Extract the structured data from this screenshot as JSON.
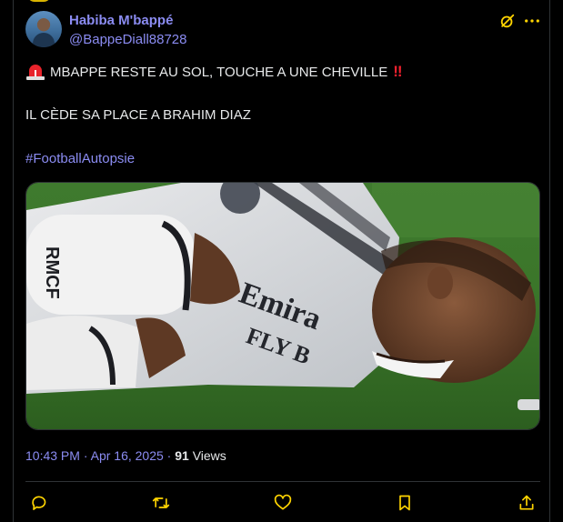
{
  "tweet": {
    "author": {
      "display_name": "Habiba M'bappé",
      "handle": "@BappeDiall88728"
    },
    "lines": {
      "first": "MBAPPE RESTE AU SOL, TOUCHE A UNE CHEVILLE",
      "second": "IL CÈDE SA PLACE A BRAHIM DIAZ",
      "hashtag": "#FootballAutopsie"
    },
    "media": {
      "shirt_text_1": "Emira",
      "shirt_text_2": "FLY B",
      "sock_text": "RMCF"
    },
    "meta": {
      "time": "10:43 PM",
      "separator1": " · ",
      "date": "Apr 16, 2025",
      "separator2": " · ",
      "views_count": "91",
      "views_label": " Views"
    }
  },
  "icons": [
    "siren-emoji",
    "double-exclamation-emoji",
    "grok-icon",
    "more-icon",
    "reply-icon",
    "retweet-icon",
    "like-icon",
    "bookmark-icon",
    "share-icon"
  ],
  "colors": {
    "background": "#000000",
    "link": "#8b8cf2",
    "text": "#e7e9ea",
    "icon": "#ffd400",
    "border": "#2f3336",
    "alert": "#f4212e"
  }
}
